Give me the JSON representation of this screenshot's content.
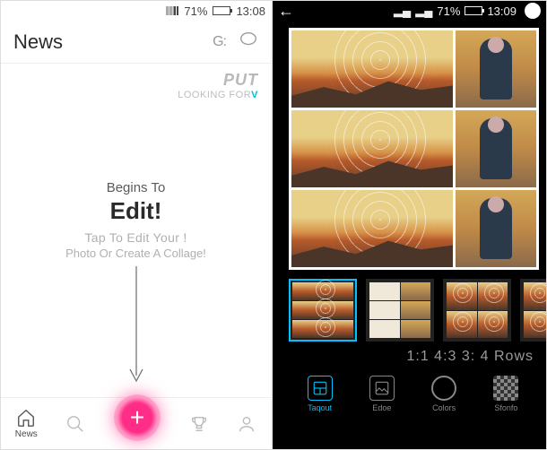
{
  "left": {
    "status": {
      "battery_pct_text": "71%",
      "battery_pct": 71,
      "time": "13:08"
    },
    "header": {
      "title": "News",
      "gz_label": "G:"
    },
    "promo": {
      "line1": "PUT",
      "line2_a": "LOOKING FOR",
      "line2_b": "V"
    },
    "hint": {
      "line1": "Begins To",
      "line2": "Edit!",
      "line3": "Tap To Edit Your !",
      "line4": "Photo Or Create A Collage!"
    },
    "nav": {
      "news": "News",
      "search": "",
      "add": "+",
      "trophy": "",
      "profile": ""
    }
  },
  "right": {
    "status": {
      "battery_pct_text": "71%",
      "battery_pct": 71,
      "time": "13:09"
    },
    "ratios_text": "1:1 4:3 3: 4 Rows",
    "tools": {
      "layout": "Taqout",
      "edge": "Edoe",
      "colors": "Colors",
      "sfondo": "Sfonfo"
    }
  }
}
